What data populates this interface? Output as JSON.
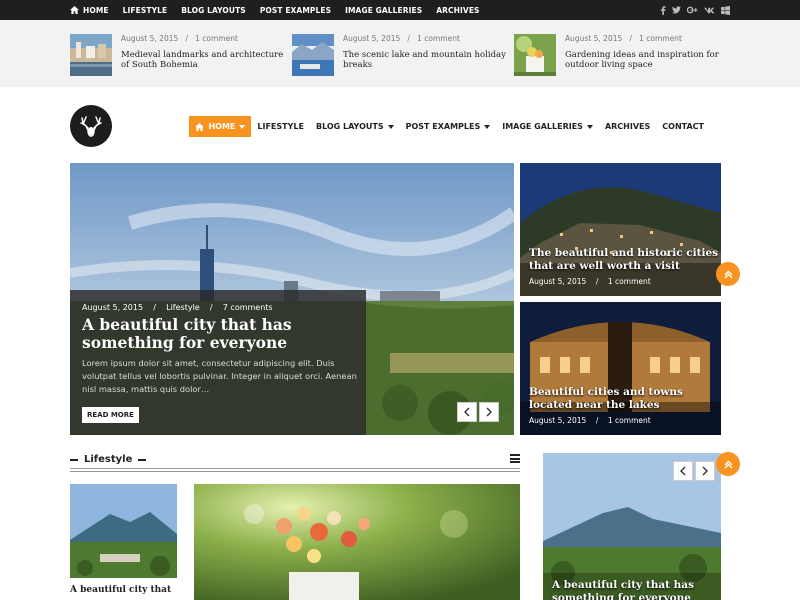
{
  "topbar": {
    "nav": [
      {
        "label": "HOME",
        "icon": "home-icon"
      },
      {
        "label": "LIFESTYLE"
      },
      {
        "label": "BLOG LAYOUTS"
      },
      {
        "label": "POST EXAMPLES"
      },
      {
        "label": "IMAGE GALLERIES"
      },
      {
        "label": "ARCHIVES"
      }
    ],
    "social": [
      "facebook-icon",
      "twitter-icon",
      "google-plus-icon",
      "vk-icon",
      "windows-icon"
    ]
  },
  "trending": [
    {
      "date": "August 5, 2015",
      "sep": "/",
      "comments": "1 comment",
      "title": "Medieval landmarks and architecture of South Bohemia"
    },
    {
      "date": "August 5, 2015",
      "sep": "/",
      "comments": "1 comment",
      "title": "The scenic lake and mountain holiday breaks"
    },
    {
      "date": "August 5, 2015",
      "sep": "/",
      "comments": "1 comment",
      "title": "Gardening ideas and inspiration for outdoor living space"
    }
  ],
  "mainnav": {
    "items": [
      {
        "label": "HOME",
        "active": true,
        "dropdown": true
      },
      {
        "label": "LIFESTYLE",
        "dropdown": false
      },
      {
        "label": "BLOG LAYOUTS",
        "dropdown": true
      },
      {
        "label": "POST EXAMPLES",
        "dropdown": true
      },
      {
        "label": "IMAGE GALLERIES",
        "dropdown": true
      },
      {
        "label": "ARCHIVES",
        "dropdown": false
      },
      {
        "label": "CONTACT",
        "dropdown": false
      }
    ]
  },
  "hero": {
    "date": "August 5, 2015",
    "sep": "/",
    "category": "Lifestyle",
    "comments": "7 comments",
    "title": "A beautiful city that has something for everyone",
    "excerpt": "Lorem ipsum dolor sit amet, consectetur adipiscing elit. Duis volutpat tellus vel lobortis pulvinar. Integer in aliquet orci. Aenean nisl massa, mattis quis dolor…",
    "read_more": "READ MORE"
  },
  "side_posts": [
    {
      "title": "The beautiful and historic cities that are well worth a visit",
      "date": "August 5, 2015",
      "sep": "/",
      "comments": "1 comment"
    },
    {
      "title": "Beautiful cities and towns located near the lakes",
      "date": "August 5, 2015",
      "sep": "/",
      "comments": "1 comment"
    }
  ],
  "section": {
    "title": "Lifestyle",
    "left_card_title": "A beautiful city that",
    "right_card_title": "A beautiful city that has something for everyone"
  },
  "colors": {
    "accent": "#f7931e",
    "topbar": "#1f1f1f",
    "strip": "#f2f2f2"
  }
}
